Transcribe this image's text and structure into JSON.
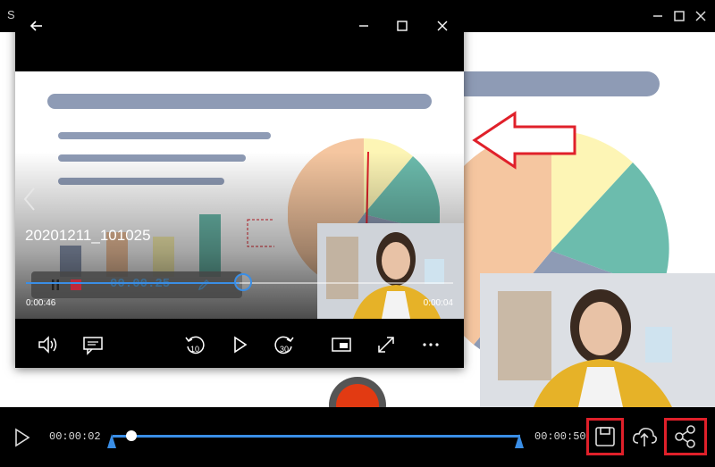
{
  "app": {
    "title": "S"
  },
  "player": {
    "video_name": "20201211_101025",
    "time_left": "0:00:46",
    "time_right": "0:00:04",
    "recorder_time": "00.00.25",
    "seek_progress_fraction": 0.5
  },
  "bottom": {
    "time_start": "00:00:02",
    "time_end": "00:00:50",
    "playhead_fraction": 0.04
  },
  "icons": {
    "back": "back-arrow-icon",
    "minimize": "minimize-icon",
    "maximize": "maximize-icon",
    "close": "close-icon",
    "volume": "volume-icon",
    "subtitles": "subtitles-icon",
    "rewind": "rewind-10-icon",
    "play": "play-icon",
    "forward": "forward-30-icon",
    "miniplayer": "miniplayer-icon",
    "fullscreen": "fullscreen-icon",
    "more": "more-icon",
    "save": "save-icon",
    "upload": "cloud-upload-icon",
    "share": "share-icon"
  },
  "colors": {
    "accent": "#3a8ee6",
    "highlight": "#e0202a",
    "slide_bar": "#8e9bb5",
    "pie_peach": "#f5c6a0",
    "pie_yellow": "#fdf5b5",
    "pie_teal": "#6cbcad",
    "pie_slate": "#8e9bb5"
  }
}
